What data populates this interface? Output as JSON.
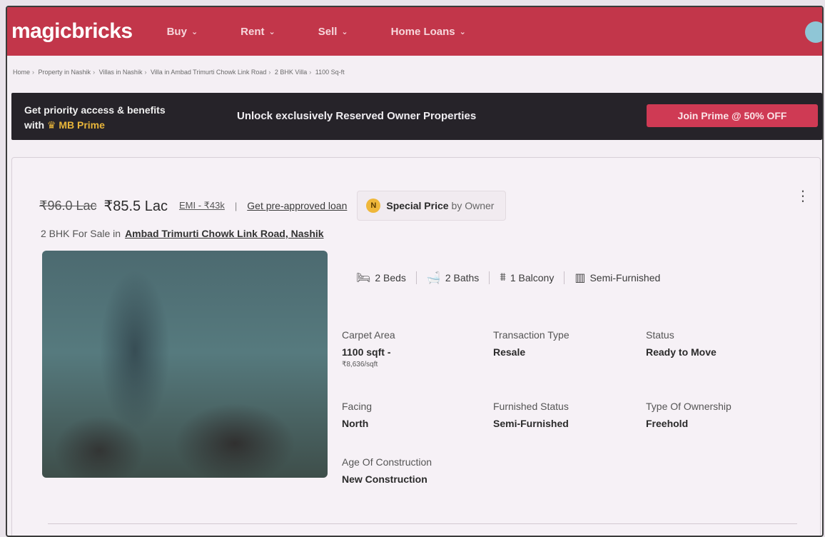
{
  "header": {
    "logo": "magicbricks",
    "nav": [
      {
        "label": "Buy"
      },
      {
        "label": "Rent"
      },
      {
        "label": "Sell"
      },
      {
        "label": "Home Loans"
      }
    ]
  },
  "breadcrumb": [
    "Home",
    "Property in Nashik",
    "Villas in Nashik",
    "Villa in Ambad Trimurti Chowk Link Road",
    "2 BHK Villa",
    "1100 Sq-ft"
  ],
  "prime": {
    "line1": "Get priority access & benefits",
    "line2_prefix": "with",
    "line2_brand": "MB Prime",
    "message": "Unlock exclusively Reserved Owner Properties",
    "button": "Join Prime @ 50% OFF"
  },
  "listing": {
    "old_price": "₹96.0 Lac",
    "price": "₹85.5 Lac",
    "emi": "EMI - ₹43k",
    "loan_link": "Get pre-approved loan",
    "special_badge": "N",
    "special_label": "Special Price",
    "special_by": "by Owner",
    "subtitle_prefix": "2 BHK For Sale in",
    "location": "Ambad Trimurti Chowk Link Road, Nashik",
    "amenities": [
      {
        "icon": "bed-icon",
        "label": "2 Beds"
      },
      {
        "icon": "bath-icon",
        "label": "2 Baths"
      },
      {
        "icon": "balcony-icon",
        "label": "1 Balcony"
      },
      {
        "icon": "furniture-icon",
        "label": "Semi-Furnished"
      }
    ],
    "details": {
      "carpet_area": {
        "label": "Carpet Area",
        "value": "1100 sqft -",
        "sub": "₹8,636/sqft"
      },
      "transaction_type": {
        "label": "Transaction Type",
        "value": "Resale"
      },
      "status": {
        "label": "Status",
        "value": "Ready to Move"
      },
      "facing": {
        "label": "Facing",
        "value": "North"
      },
      "furnished_status": {
        "label": "Furnished Status",
        "value": "Semi-Furnished"
      },
      "ownership": {
        "label": "Type Of Ownership",
        "value": "Freehold"
      },
      "age": {
        "label": "Age Of Construction",
        "value": "New Construction"
      }
    }
  },
  "colors": {
    "brand": "#c2364a",
    "prime_bg": "#262329",
    "prime_button": "#cf3a54",
    "prime_accent": "#e8b53a"
  }
}
